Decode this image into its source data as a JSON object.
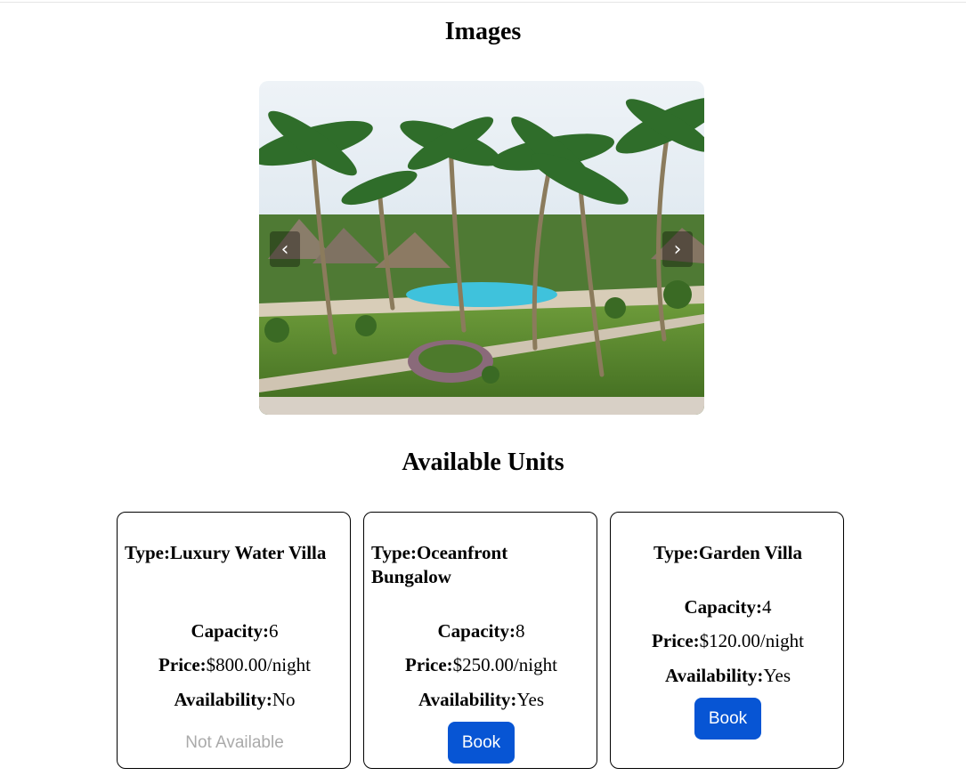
{
  "sections": {
    "images_heading": "Images",
    "units_heading": "Available Units"
  },
  "carousel": {
    "prev_label": "‹",
    "next_label": "›",
    "image_desc": "resort-pool-palms-photo"
  },
  "units": [
    {
      "type_label": "Type:",
      "type_value": "Luxury Water Villa",
      "capacity_label": "Capacity:",
      "capacity_value": "6",
      "price_label": "Price:",
      "price_value": "$800.00/night",
      "availability_label": "Availability:",
      "availability_value": "No",
      "action_label": "Not Available"
    },
    {
      "type_label": "Type:",
      "type_value": "Oceanfront Bungalow",
      "capacity_label": "Capacity:",
      "capacity_value": "8",
      "price_label": "Price:",
      "price_value": "$250.00/night",
      "availability_label": "Availability:",
      "availability_value": "Yes",
      "action_label": "Book"
    },
    {
      "type_label": "Type:",
      "type_value": "Garden Villa",
      "capacity_label": "Capacity:",
      "capacity_value": "4",
      "price_label": "Price:",
      "price_value": "$120.00/night",
      "availability_label": "Availability:",
      "availability_value": "Yes",
      "action_label": "Book"
    }
  ],
  "colors": {
    "book_button": "#0755d4",
    "disabled_text": "#aaaaaa"
  }
}
